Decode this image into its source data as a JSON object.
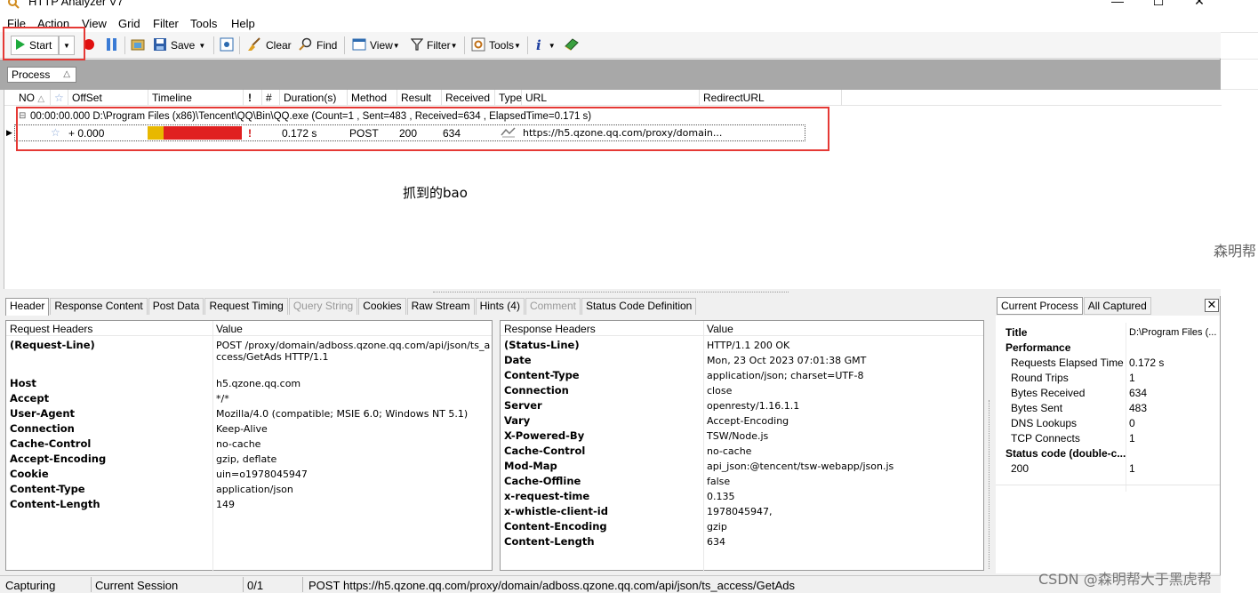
{
  "window": {
    "title": "HTTP Analyzer V7",
    "minimize_glyph": "—",
    "maximize_glyph": "☐",
    "close_glyph": "✕"
  },
  "menu": [
    "File",
    "Action",
    "View",
    "Grid",
    "Filter",
    "Tools",
    "Help"
  ],
  "toolbar": {
    "start_label": "Start",
    "save_label": "Save",
    "clear_label": "Clear",
    "find_label": "Find",
    "view_label": "View",
    "filter_label": "Filter",
    "tools_label": "Tools"
  },
  "grouping": {
    "chip_label": "Process",
    "chip_sort": "△"
  },
  "grid": {
    "columns": [
      "NO",
      "OffSet",
      "Timeline",
      "!",
      "#",
      "Duration(s)",
      "Method",
      "Result",
      "Received",
      "Type",
      "URL",
      "RedirectURL"
    ],
    "group_row": "00:00:00.000   D:\\Program Files (x86)\\Tencent\\QQ\\Bin\\QQ.exe  (Count=1 , Sent=483 , Received=634 , ElapsedTime=0.171 s)",
    "request": {
      "offset": "+ 0.000",
      "flag": "!",
      "duration": "0.172 s",
      "method": "POST",
      "result": "200",
      "received": "634",
      "url": "https://h5.qzone.qq.com/proxy/domain..."
    }
  },
  "annotation": "抓到的bao",
  "bottom_tabs": [
    {
      "label": "Header",
      "state": "active"
    },
    {
      "label": "Response Content",
      "state": "normal"
    },
    {
      "label": "Post Data",
      "state": "normal"
    },
    {
      "label": "Request Timing",
      "state": "normal"
    },
    {
      "label": "Query String",
      "state": "disabled"
    },
    {
      "label": "Cookies",
      "state": "normal"
    },
    {
      "label": "Raw Stream",
      "state": "normal"
    },
    {
      "label": "Hints (4)",
      "state": "normal"
    },
    {
      "label": "Comment",
      "state": "disabled"
    },
    {
      "label": "Status Code Definition",
      "state": "normal"
    }
  ],
  "request_headers": {
    "col_name": "Request Headers",
    "col_value": "Value",
    "rows": [
      {
        "k": "(Request-Line)",
        "v": "POST /proxy/domain/adboss.qzone.qq.com/api/json/ts_access/GetAds HTTP/1.1"
      },
      {
        "k": "Host",
        "v": "h5.qzone.qq.com"
      },
      {
        "k": "Accept",
        "v": "*/*"
      },
      {
        "k": "User-Agent",
        "v": "Mozilla/4.0 (compatible; MSIE 6.0; Windows NT 5.1)"
      },
      {
        "k": "Connection",
        "v": "Keep-Alive"
      },
      {
        "k": "Cache-Control",
        "v": "no-cache"
      },
      {
        "k": "Accept-Encoding",
        "v": "gzip, deflate"
      },
      {
        "k": "Cookie",
        "v": "uin=o1978045947"
      },
      {
        "k": "Content-Type",
        "v": "application/json"
      },
      {
        "k": "Content-Length",
        "v": "149"
      }
    ]
  },
  "response_headers": {
    "col_name": "Response Headers",
    "col_value": "Value",
    "rows": [
      {
        "k": "(Status-Line)",
        "v": "HTTP/1.1 200 OK"
      },
      {
        "k": "Date",
        "v": "Mon, 23 Oct 2023 07:01:38 GMT"
      },
      {
        "k": "Content-Type",
        "v": "application/json; charset=UTF-8"
      },
      {
        "k": "Connection",
        "v": "close"
      },
      {
        "k": "Server",
        "v": "openresty/1.16.1.1"
      },
      {
        "k": "Vary",
        "v": "Accept-Encoding"
      },
      {
        "k": "X-Powered-By",
        "v": "TSW/Node.js"
      },
      {
        "k": "Cache-Control",
        "v": "no-cache"
      },
      {
        "k": "Mod-Map",
        "v": "api_json:@tencent/tsw-webapp/json.js"
      },
      {
        "k": "Cache-Offline",
        "v": "false"
      },
      {
        "k": "x-request-time",
        "v": "0.135"
      },
      {
        "k": "x-whistle-client-id",
        "v": "1978045947,"
      },
      {
        "k": "Content-Encoding",
        "v": "gzip"
      },
      {
        "k": "Content-Length",
        "v": "634"
      }
    ]
  },
  "right_panel": {
    "tabs": [
      "Current Process",
      "All Captured"
    ],
    "close_glyph": "✕",
    "rows": [
      {
        "k": "Title",
        "v": "D:\\Program Files (...",
        "type": "bold"
      },
      {
        "k": "Performance",
        "v": "",
        "type": "section"
      },
      {
        "k": "Requests Elapsed Time",
        "v": "0.172 s",
        "type": "item"
      },
      {
        "k": "Round Trips",
        "v": "1",
        "type": "item"
      },
      {
        "k": "Bytes Received",
        "v": "634",
        "type": "item"
      },
      {
        "k": "Bytes Sent",
        "v": "483",
        "type": "item"
      },
      {
        "k": "DNS Lookups",
        "v": "0",
        "type": "item"
      },
      {
        "k": "TCP Connects",
        "v": "1",
        "type": "item"
      },
      {
        "k": "Status code (double-c...",
        "v": "",
        "type": "section"
      },
      {
        "k": "200",
        "v": "1",
        "type": "item"
      }
    ]
  },
  "statusbar": {
    "state": "Capturing",
    "session": "Current Session",
    "count": "0/1",
    "method": "POST",
    "url": "https://h5.qzone.qq.com/proxy/domain/adboss.qzone.qq.com/api/json/ts_access/GetAds"
  },
  "background": {
    "side_text": "森明帮",
    "watermark": "CSDN @森明帮大于黑虎帮"
  },
  "colors": {
    "highlight_box": "#e53935",
    "timeline_wait": "#e8b800",
    "timeline_receive": "#e02020",
    "grouping_bg": "#a8a8a8"
  }
}
